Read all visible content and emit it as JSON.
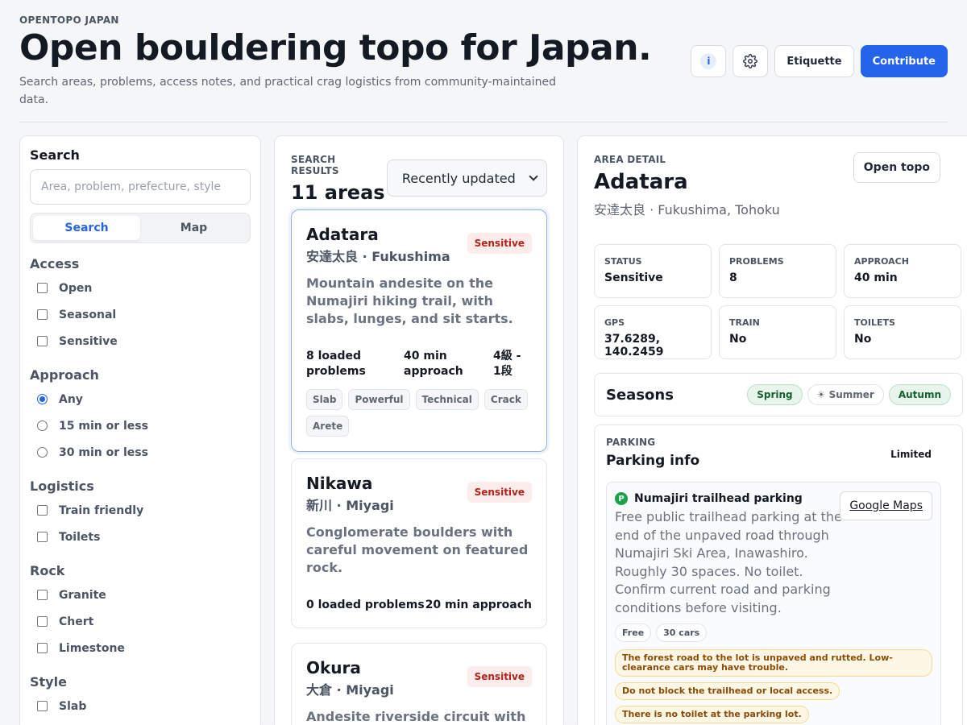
{
  "header": {
    "eyebrow": "OPENTOPO JAPAN",
    "title": "Open bouldering topo for Japan.",
    "subtitle": "Search areas, problems, access notes, and practical crag logistics from community-maintained data.",
    "info_label": "i",
    "etiquette_label": "Etiquette",
    "contribute_label": "Contribute"
  },
  "filters": {
    "search_label": "Search",
    "search_placeholder": "Area, problem, prefecture, style",
    "search_value": "",
    "view_tabs": [
      "Search",
      "Map"
    ],
    "active_tab": "Search",
    "groups": [
      {
        "title": "Access",
        "type": "checkbox",
        "options": [
          "Open",
          "Seasonal",
          "Sensitive"
        ]
      },
      {
        "title": "Approach",
        "type": "radio",
        "options": [
          "Any",
          "15 min or less",
          "30 min or less"
        ],
        "selected": "Any"
      },
      {
        "title": "Logistics",
        "type": "checkbox",
        "options": [
          "Train friendly",
          "Toilets"
        ]
      },
      {
        "title": "Rock",
        "type": "checkbox",
        "options": [
          "Granite",
          "Chert",
          "Limestone"
        ]
      },
      {
        "title": "Style",
        "type": "checkbox",
        "options": [
          "Slab"
        ]
      }
    ]
  },
  "results": {
    "label": "SEARCH RESULTS",
    "count": "11 areas",
    "sort_value": "Recently updated",
    "cards": [
      {
        "name": "Adatara",
        "sub": "安達太良 · Fukushima",
        "badge": "Sensitive",
        "desc": "Mountain andesite on the Numajiri hiking trail, with slabs, lunges, and sit starts.",
        "problems": "8 loaded problems",
        "approach": "40 min approach",
        "grades": "4級 - 1段",
        "tags": [
          "Slab",
          "Powerful",
          "Technical",
          "Crack",
          "Arete"
        ]
      },
      {
        "name": "Nikawa",
        "sub": "新川 · Miyagi",
        "badge": "Sensitive",
        "desc": "Conglomerate boulders with careful movement on featured rock.",
        "problems": "0 loaded problems",
        "approach": "20 min approach"
      },
      {
        "name": "Okura",
        "sub": "大倉 · Miyagi",
        "badge": "Sensitive",
        "desc": "Andesite riverside circuit with"
      }
    ]
  },
  "detail": {
    "label": "AREA DETAIL",
    "name": "Adatara",
    "sub": "安達太良 · Fukushima, Tohoku",
    "open_topo_label": "Open topo",
    "stats": [
      {
        "key": "STATUS",
        "value": "Sensitive"
      },
      {
        "key": "PROBLEMS",
        "value": "8"
      },
      {
        "key": "APPROACH",
        "value": "40 min"
      },
      {
        "key": "GPS",
        "value": "37.6289, 140.2459"
      },
      {
        "key": "TRAIN",
        "value": "No"
      },
      {
        "key": "TOILETS",
        "value": "No"
      }
    ],
    "seasons_title": "Seasons",
    "seasons": [
      {
        "label": "Spring",
        "active": true
      },
      {
        "label": "☀ Summer",
        "active": false
      },
      {
        "label": "Autumn",
        "active": true
      }
    ],
    "parking": {
      "label": "PARKING",
      "title": "Parking info",
      "status": "Limited",
      "lot": {
        "marker": "P",
        "name": "Numajiri trailhead parking",
        "maps_label": "Google Maps",
        "desc": "Free public trailhead parking at the end of the unpaved road through Numajiri Ski Area, Inawashiro. Roughly 30 spaces. No toilet. Confirm current road and parking conditions before visiting.",
        "tags": [
          "Free",
          "30 cars"
        ],
        "warnings": [
          "The forest road to the lot is unpaved and rutted. Low-clearance cars may have trouble.",
          "Do not block the trailhead or local access.",
          "There is no toilet at the parking lot."
        ]
      }
    }
  },
  "colors": {
    "accent": "#2563eb",
    "sensitive_bg": "#fdecec",
    "sensitive_text": "#b42318",
    "season_active_bg": "#e8f5ec",
    "warning_bg": "#fff7e6"
  }
}
